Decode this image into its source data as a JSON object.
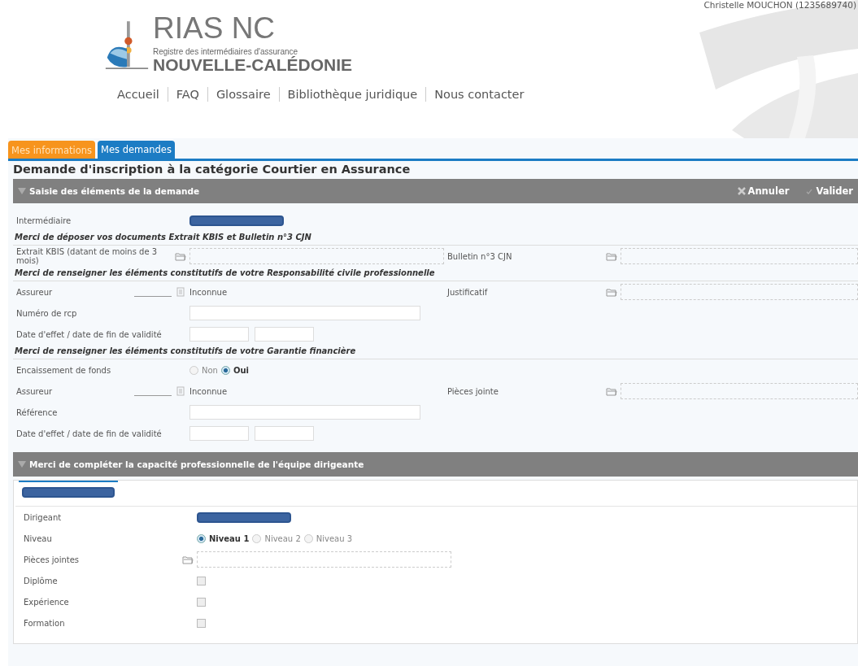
{
  "user": "Christelle MOUCHON (1235689740)",
  "logo": {
    "title": "RIAS NC",
    "subtitle": "Registre des intermédiaires d'assurance",
    "region": "NOUVELLE-CALÉDONIE"
  },
  "nav": [
    "Accueil",
    "FAQ",
    "Glossaire",
    "Bibliothèque juridique",
    "Nous contacter"
  ],
  "tabs": [
    {
      "label": "Mes informations",
      "selected": false
    },
    {
      "label": "Mes demandes",
      "selected": true
    }
  ],
  "page_title": "Demande d'inscription à la catégorie Courtier en Assurance",
  "sections": [
    {
      "title": "Saisie des éléments de la demande",
      "expanded": true,
      "actions": [
        {
          "label": "Annuler",
          "kind": "cancel"
        },
        {
          "label": "Valider",
          "kind": "validate"
        }
      ],
      "rows": [
        {
          "kind": "fields",
          "left": {
            "label": "Intermédiaire",
            "kind": "redacted"
          }
        },
        {
          "kind": "heading",
          "text": "Merci de déposer vos documents Extrait KBIS et Bulletin n°3 CJN"
        },
        {
          "kind": "fields",
          "left": {
            "label": "Extrait KBIS (datant de moins de 3 mois)",
            "kind": "file"
          },
          "right": {
            "label": "Bulletin n°3 CJN",
            "kind": "file"
          }
        },
        {
          "kind": "heading",
          "text": "Merci de renseigner les éléments constitutifs de votre Responsabilité civile professionnelle"
        },
        {
          "kind": "fields",
          "left": {
            "label": "Assureur",
            "kind": "insurer",
            "value": "Inconnue"
          },
          "right": {
            "label": "Justificatif",
            "kind": "file"
          }
        },
        {
          "kind": "fields",
          "left": {
            "label": "Numéro de rcp",
            "kind": "text"
          }
        },
        {
          "kind": "fields",
          "left": {
            "label": "Date d'effet / date de fin de validité",
            "kind": "dates"
          }
        },
        {
          "kind": "heading",
          "text": "Merci de renseigner les éléments constitutifs de votre Garantie financière"
        },
        {
          "kind": "fields",
          "left": {
            "label": "Encaissement de fonds",
            "kind": "radios",
            "options": [
              {
                "label": "Non",
                "selected": false
              },
              {
                "label": "Oui",
                "selected": true
              }
            ]
          }
        },
        {
          "kind": "fields",
          "left": {
            "label": "Assureur",
            "kind": "insurer",
            "value": "Inconnue"
          },
          "right": {
            "label": "Pièces jointe",
            "kind": "file"
          }
        },
        {
          "kind": "fields",
          "left": {
            "label": "Référence",
            "kind": "text"
          }
        },
        {
          "kind": "fields",
          "left": {
            "label": "Date d'effet / date de fin de validité",
            "kind": "dates"
          }
        }
      ]
    },
    {
      "title": "Merci de compléter la capacité professionnelle de l'équipe dirigeante",
      "expanded": true,
      "subtab": {
        "kind": "redacted",
        "selected": true
      },
      "rows": [
        {
          "kind": "fields",
          "left": {
            "label": "Dirigeant",
            "kind": "redacted"
          }
        },
        {
          "kind": "fields",
          "left": {
            "label": "Niveau",
            "kind": "radios",
            "options": [
              {
                "label": "Niveau 1",
                "selected": true
              },
              {
                "label": "Niveau 2",
                "selected": false
              },
              {
                "label": "Niveau 3",
                "selected": false
              }
            ]
          }
        },
        {
          "kind": "fields",
          "left": {
            "label": "Pièces jointes",
            "kind": "file"
          }
        },
        {
          "kind": "fields",
          "left": {
            "label": "Diplôme",
            "kind": "checkbox",
            "checked": false
          }
        },
        {
          "kind": "fields",
          "left": {
            "label": "Expérience",
            "kind": "checkbox",
            "checked": false
          }
        },
        {
          "kind": "fields",
          "left": {
            "label": "Formation",
            "kind": "checkbox",
            "checked": false
          }
        }
      ]
    }
  ]
}
